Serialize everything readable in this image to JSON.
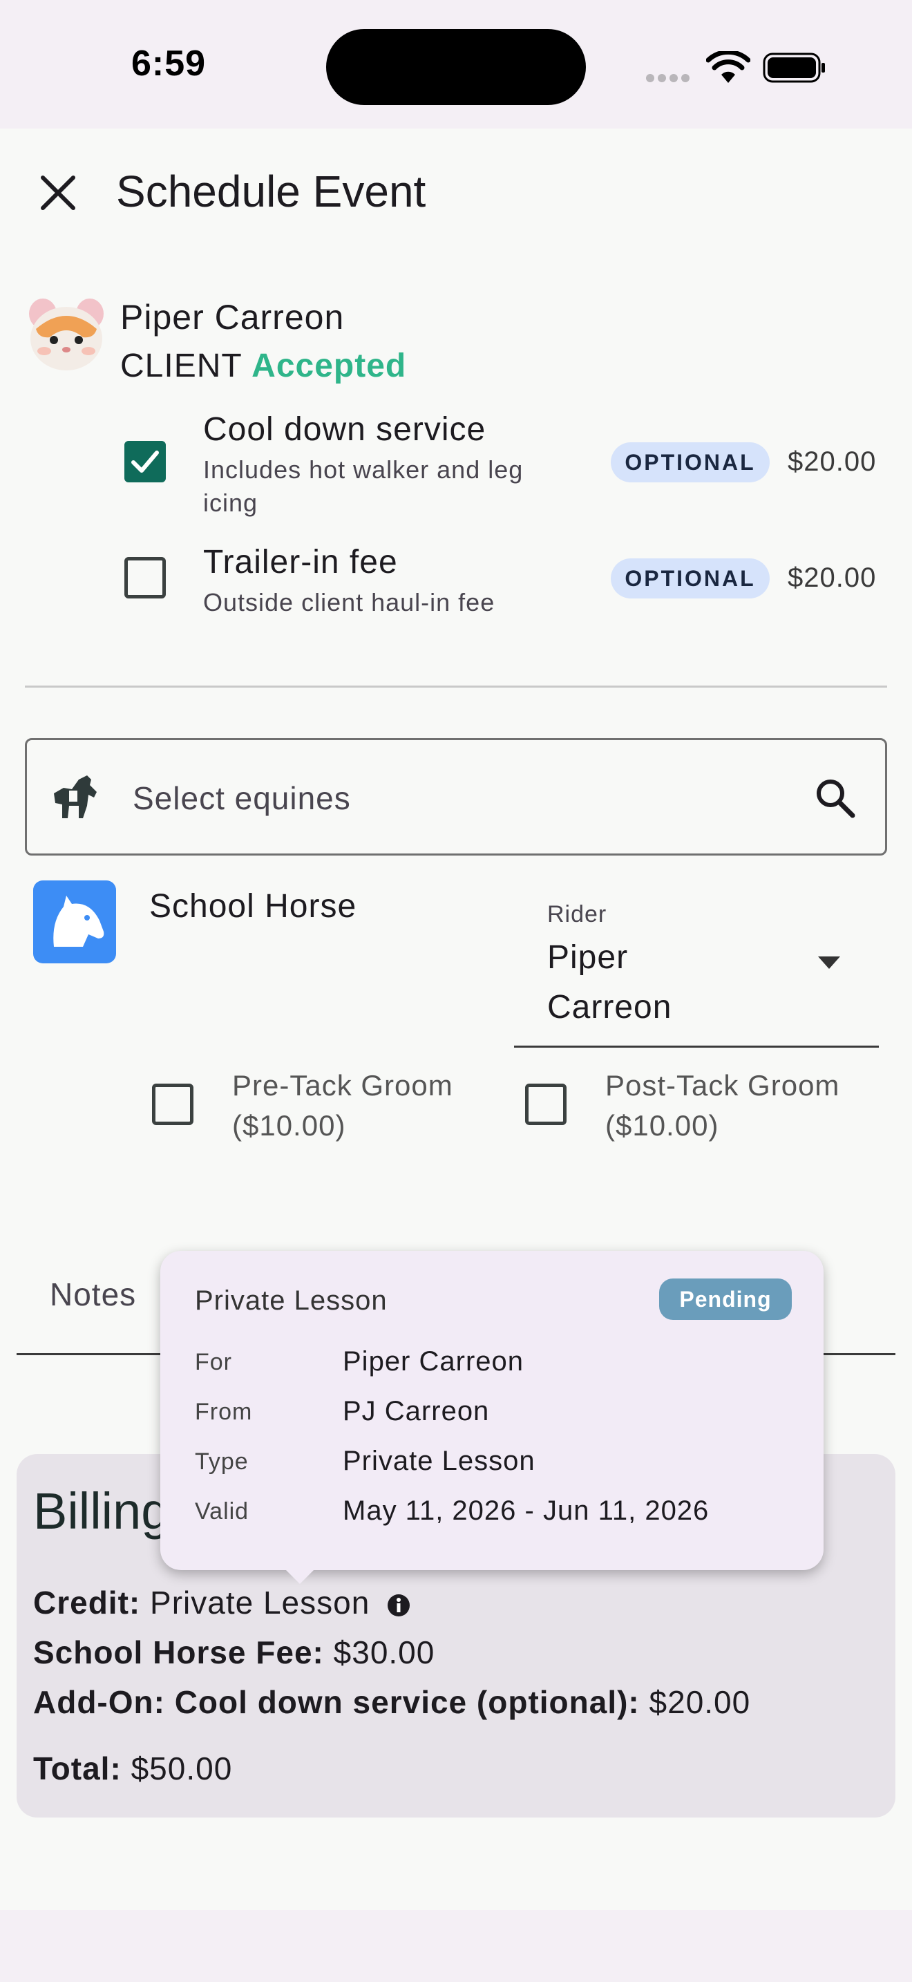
{
  "status_bar": {
    "time": "6:59"
  },
  "header": {
    "title": "Schedule Event"
  },
  "client": {
    "name": "Piper Carreon",
    "role": "CLIENT",
    "status": "Accepted",
    "avatar_icon": "hamster-emoji"
  },
  "addons": [
    {
      "title": "Cool down service",
      "description": "Includes hot walker and leg icing",
      "badge": "OPTIONAL",
      "price": "$20.00",
      "checked": true
    },
    {
      "title": "Trailer-in fee",
      "description": "Outside client haul-in fee",
      "badge": "OPTIONAL",
      "price": "$20.00",
      "checked": false
    }
  ],
  "search": {
    "placeholder": "Select equines"
  },
  "equine": {
    "name": "School Horse",
    "rider_label": "Rider",
    "rider_value": "Piper Carreon",
    "pre_tack": "Pre-Tack Groom ($10.00)",
    "post_tack": "Post-Tack Groom ($10.00)"
  },
  "tabs": {
    "notes": "Notes"
  },
  "billing": {
    "title": "Billing",
    "credit_label": "Credit:",
    "credit_value": "Private Lesson",
    "fee_label": "School Horse Fee:",
    "fee_value": "$30.00",
    "addon_label": "Add-On: Cool down service (optional):",
    "addon_value": "$20.00",
    "total_label": "Total:",
    "total_value": "$50.00"
  },
  "popover": {
    "title": "Private Lesson",
    "badge": "Pending",
    "rows": [
      {
        "key": "For",
        "value": "Piper Carreon"
      },
      {
        "key": "From",
        "value": "PJ Carreon"
      },
      {
        "key": "Type",
        "value": "Private Lesson"
      },
      {
        "key": "Valid",
        "value": "May 11, 2026 - Jun 11, 2026"
      }
    ]
  }
}
